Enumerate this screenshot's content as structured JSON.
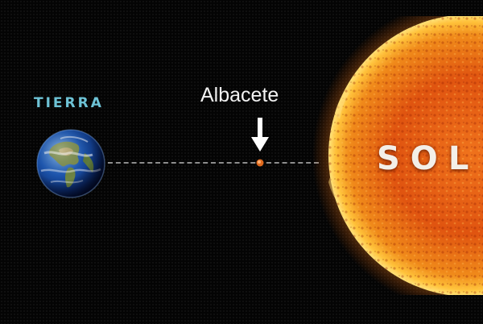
{
  "labels": {
    "earth": "TIERRA",
    "city": "Albacete",
    "sun": "SOL"
  },
  "icons": {
    "earth": "earth-globe-icon",
    "arrow": "down-arrow-icon",
    "city_marker": "location-dot-icon",
    "sun": "sun-icon"
  },
  "colors": {
    "background": "#040404",
    "earth_label": "#6ec3d6",
    "city_label": "#f2f2f2",
    "sun_label": "#f3efe8",
    "orbit_line": "#8d8d8d",
    "sun_core": "#d9480d",
    "sun_glow": "#ffb020"
  }
}
